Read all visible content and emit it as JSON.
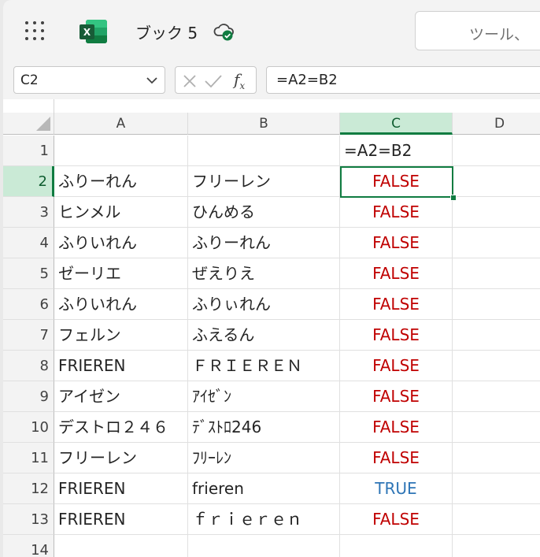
{
  "app": {
    "doc_title": "ブック 5",
    "search_placeholder": "ツール、",
    "icons": {
      "launcher": "app-launcher-icon",
      "logo": "excel-logo-icon",
      "cloud": "cloud-saved-icon"
    }
  },
  "formula_bar": {
    "name_box": "C2",
    "formula": "=A2=B2",
    "fx_label": "f",
    "fx_sub": "x"
  },
  "columns": [
    "A",
    "B",
    "C",
    "D"
  ],
  "selected_column": "C",
  "rows": [
    {
      "num": "1",
      "a": "",
      "b": "",
      "c": "=A2=B2",
      "c_type": "formula"
    },
    {
      "num": "2",
      "a": "ふりーれん",
      "b": "フリーレン",
      "c": "FALSE",
      "c_type": "false"
    },
    {
      "num": "3",
      "a": "ヒンメル",
      "b": "ひんめる",
      "c": "FALSE",
      "c_type": "false"
    },
    {
      "num": "4",
      "a": "ふりいれん",
      "b": "ふりーれん",
      "c": "FALSE",
      "c_type": "false"
    },
    {
      "num": "5",
      "a": "ゼーリエ",
      "b": "ぜえりえ",
      "c": "FALSE",
      "c_type": "false"
    },
    {
      "num": "6",
      "a": "ふりいれん",
      "b": "ふりぃれん",
      "c": "FALSE",
      "c_type": "false"
    },
    {
      "num": "7",
      "a": "フェルン",
      "b": "ふえるん",
      "c": "FALSE",
      "c_type": "false"
    },
    {
      "num": "8",
      "a": "FRIEREN",
      "b": "ＦＲＩＥＲＥＮ",
      "c": "FALSE",
      "c_type": "false"
    },
    {
      "num": "9",
      "a": "アイゼン",
      "b": "ｱｲｾﾞﾝ",
      "c": "FALSE",
      "c_type": "false"
    },
    {
      "num": "10",
      "a": "デストロ２４６",
      "b": "ﾃﾞｽﾄﾛ246",
      "c": "FALSE",
      "c_type": "false"
    },
    {
      "num": "11",
      "a": "フリーレン",
      "b": "ﾌﾘｰﾚﾝ",
      "c": "FALSE",
      "c_type": "false"
    },
    {
      "num": "12",
      "a": "FRIEREN",
      "b": "frieren",
      "c": "TRUE",
      "c_type": "true"
    },
    {
      "num": "13",
      "a": "FRIEREN",
      "b": "ｆｒｉｅｒｅｎ",
      "c": "FALSE",
      "c_type": "false"
    },
    {
      "num": "14",
      "a": "",
      "b": "",
      "c": "",
      "c_type": "empty"
    }
  ],
  "active_cell": "C2",
  "colors": {
    "accent": "#107c41",
    "false_text": "#c00000",
    "true_text": "#2e75b6"
  }
}
